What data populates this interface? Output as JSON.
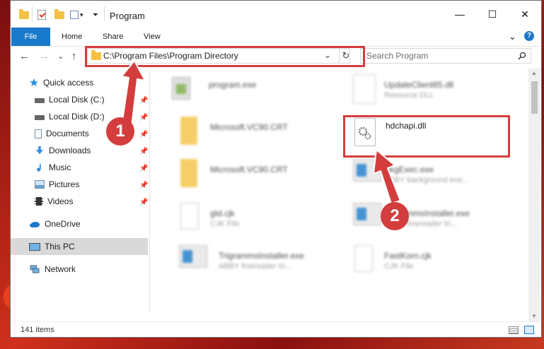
{
  "window": {
    "title": "Program",
    "minimize": "—",
    "maximize": "☐",
    "close": "✕"
  },
  "ribbon": {
    "tabs": [
      "File",
      "Home",
      "Share",
      "View"
    ],
    "expand": "⌄",
    "help": "?"
  },
  "nav": {
    "back": "←",
    "forward": "→",
    "recent": "⌄",
    "up": "↑",
    "address": "C:\\Program Files\\Program Directory",
    "dropdown": "⌄",
    "refresh": "↻",
    "search_placeholder": "Search Program"
  },
  "sidebar": {
    "items": [
      {
        "label": "Quick access",
        "icon": "star-icon",
        "pinned": false
      },
      {
        "label": "Local Disk (C:)",
        "icon": "drive-icon",
        "pinned": true
      },
      {
        "label": "Local Disk (D:)",
        "icon": "drive-icon",
        "pinned": true
      },
      {
        "label": "Documents",
        "icon": "document-icon",
        "pinned": true
      },
      {
        "label": "Downloads",
        "icon": "download-icon",
        "pinned": true
      },
      {
        "label": "Music",
        "icon": "music-icon",
        "pinned": true
      },
      {
        "label": "Pictures",
        "icon": "picture-icon",
        "pinned": true
      },
      {
        "label": "Videos",
        "icon": "video-icon",
        "pinned": true
      },
      {
        "label": "OneDrive",
        "icon": "cloud-icon",
        "pinned": false
      },
      {
        "label": "This PC",
        "icon": "computer-icon",
        "pinned": false
      },
      {
        "label": "Network",
        "icon": "network-icon",
        "pinned": false
      }
    ]
  },
  "files": [
    {
      "name": "program.exe",
      "desc": "",
      "type": "exe"
    },
    {
      "name": "UpdateClient65.dll",
      "desc": "Resource DLL",
      "type": "dll"
    },
    {
      "name": "Microsoft.VC90.CRT",
      "desc": "",
      "type": "folder"
    },
    {
      "name": "hdchapi.dll",
      "desc": "",
      "type": "dll"
    },
    {
      "name": "Microsoft.VC90.CRT",
      "desc": "",
      "type": "folder"
    },
    {
      "name": "BkgExec.exe",
      "desc": "ABBY background exe...",
      "type": "app"
    },
    {
      "name": "gtd.cjk",
      "desc": "CJK File",
      "type": "doc"
    },
    {
      "name": "TrigrammsInstaller.exe",
      "desc": "ABBY finereader tri...",
      "type": "app"
    },
    {
      "name": "TrigrammsInstaller.exe",
      "desc": "ABBY finereader tri...",
      "type": "app"
    },
    {
      "name": "FastKorn.cjk",
      "desc": "CJK File",
      "type": "doc"
    }
  ],
  "status": {
    "item_count": "141 items"
  },
  "annotations": {
    "step1": "1",
    "step2": "2"
  },
  "colors": {
    "accent": "#1979ca",
    "highlight": "#d43d3d",
    "folder": "#f3c244"
  }
}
